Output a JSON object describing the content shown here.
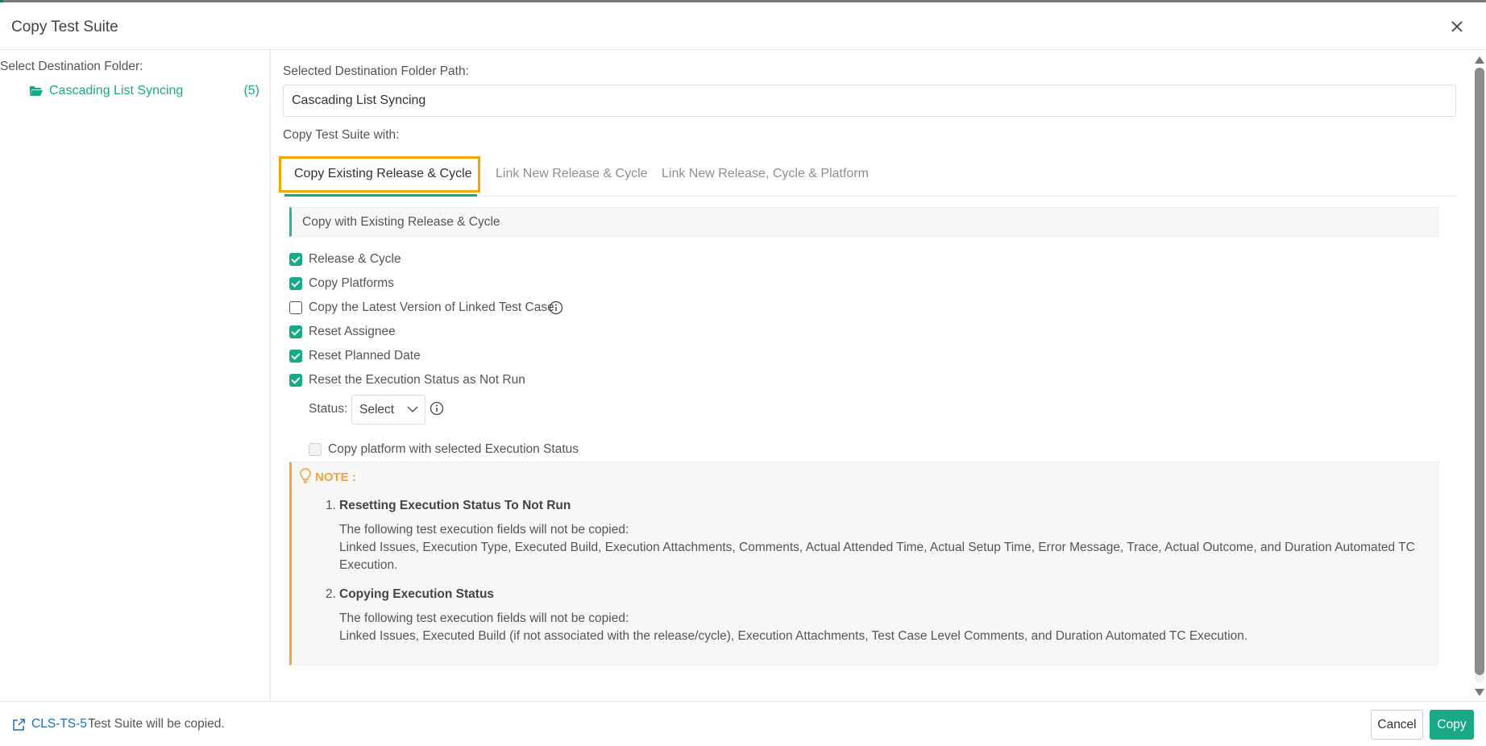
{
  "dialog": {
    "title": "Copy Test Suite",
    "close_icon": "close-icon"
  },
  "left_panel": {
    "label": "Select Destination Folder:",
    "folders": [
      {
        "name": "Cascading List Syncing",
        "count": "(5)",
        "icon": "folder-open-icon"
      }
    ]
  },
  "main": {
    "path_label": "Selected Destination Folder Path:",
    "path_value": "Cascading List Syncing",
    "copy_with_label": "Copy Test Suite with:",
    "tabs": [
      {
        "label": "Copy Existing Release & Cycle",
        "active": true
      },
      {
        "label": "Link New Release & Cycle",
        "active": false
      },
      {
        "label": "Link New Release, Cycle & Platform",
        "active": false
      }
    ],
    "section_title": "Copy with Existing Release & Cycle",
    "options": [
      {
        "label": "Release & Cycle",
        "checked": true
      },
      {
        "label": "Copy Platforms",
        "checked": true
      },
      {
        "label": "Copy the Latest Version of Linked Test Case",
        "checked": false
      },
      {
        "label": "Reset Assignee",
        "checked": true
      },
      {
        "label": "Reset Planned Date",
        "checked": true
      },
      {
        "label": "Reset the Execution Status as Not Run",
        "checked": true
      }
    ],
    "status_label": "Status:",
    "status_value": "Select",
    "copy_platform_label": "Copy platform with selected Execution Status",
    "note": {
      "title": "NOTE :",
      "items": [
        {
          "num": "1.",
          "heading": "Resetting Execution Status To Not Run",
          "line1": "The following test execution fields will not be copied:",
          "line2": "Linked Issues, Execution Type, Executed Build, Execution Attachments, Comments, Actual Attended Time, Actual Setup Time, Error Message, Trace, Actual Outcome, and Duration Automated TC Execution."
        },
        {
          "num": "2.",
          "heading": "Copying Execution Status",
          "line1": "The following test execution fields will not be copied:",
          "line2": "Linked Issues, Executed Build (if not associated with the release/cycle), Execution Attachments, Test Case Level Comments, and Duration Automated TC Execution."
        }
      ]
    }
  },
  "footer": {
    "suite_id": "CLS-TS-5",
    "message": "Test Suite will be copied.",
    "cancel_label": "Cancel",
    "copy_label": "Copy"
  },
  "colors": {
    "accent": "#19a987",
    "highlight": "#f0a500",
    "note": "#f3a43a",
    "link": "#1d6fb8"
  }
}
